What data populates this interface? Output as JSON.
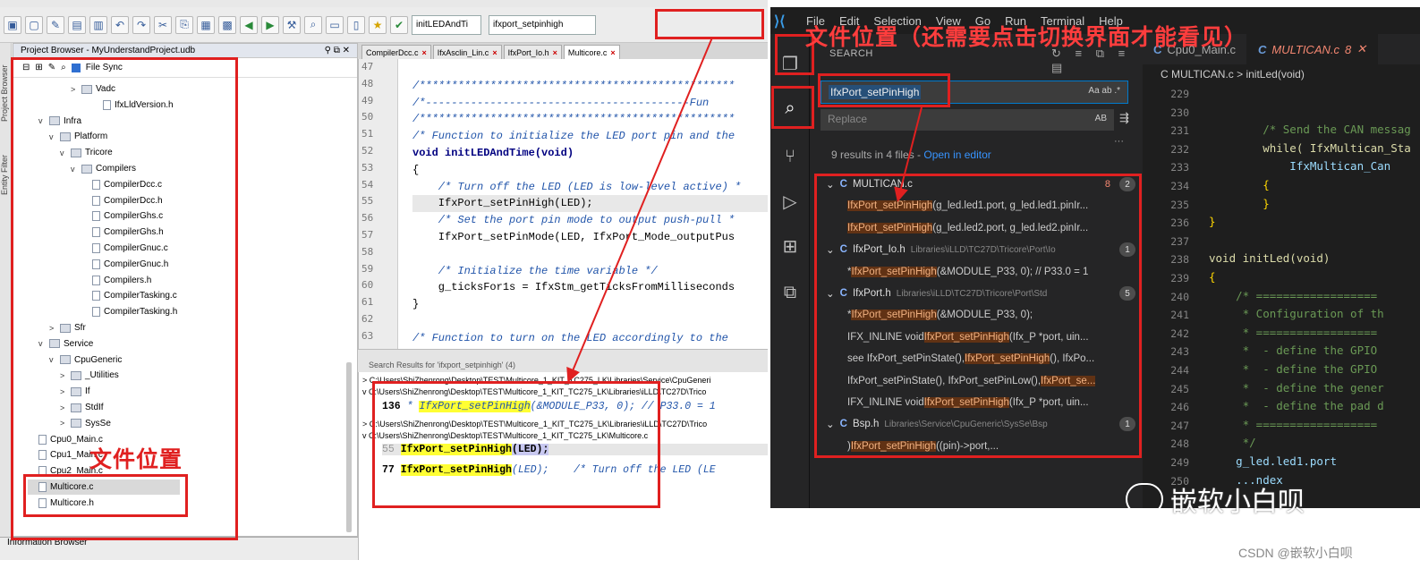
{
  "understand": {
    "search_combo_1": "initLEDAndTi",
    "search_combo_2": "ifxport_setpinhigh",
    "project_browser_title": "Project Browser - MyUnderstandProject.udb",
    "vtab_1": "Project Browser",
    "vtab_2": "Entity Filter",
    "file_sync": "File Sync",
    "tree": [
      {
        "label": "Vadc",
        "kind": "folder",
        "twisty": ">"
      },
      {
        "label": "IfxLldVersion.h",
        "kind": "file",
        "twisty": ""
      },
      {
        "label": "Infra",
        "kind": "folder",
        "twisty": "v"
      },
      {
        "label": "Platform",
        "kind": "folder",
        "twisty": "v"
      },
      {
        "label": "Tricore",
        "kind": "folder",
        "twisty": "v"
      },
      {
        "label": "Compilers",
        "kind": "folder",
        "twisty": "v"
      },
      {
        "label": "CompilerDcc.c",
        "kind": "file",
        "twisty": ""
      },
      {
        "label": "CompilerDcc.h",
        "kind": "file",
        "twisty": ""
      },
      {
        "label": "CompilerGhs.c",
        "kind": "file",
        "twisty": ""
      },
      {
        "label": "CompilerGhs.h",
        "kind": "file",
        "twisty": ""
      },
      {
        "label": "CompilerGnuc.c",
        "kind": "file",
        "twisty": ""
      },
      {
        "label": "CompilerGnuc.h",
        "kind": "file",
        "twisty": ""
      },
      {
        "label": "Compilers.h",
        "kind": "file",
        "twisty": ""
      },
      {
        "label": "CompilerTasking.c",
        "kind": "file",
        "twisty": ""
      },
      {
        "label": "CompilerTasking.h",
        "kind": "file",
        "twisty": ""
      },
      {
        "label": "Sfr",
        "kind": "folder",
        "twisty": ">"
      },
      {
        "label": "Service",
        "kind": "folder",
        "twisty": "v"
      },
      {
        "label": "CpuGeneric",
        "kind": "folder",
        "twisty": "v"
      },
      {
        "label": "_Utilities",
        "kind": "folder",
        "twisty": ">"
      },
      {
        "label": "If",
        "kind": "folder",
        "twisty": ">"
      },
      {
        "label": "StdIf",
        "kind": "folder",
        "twisty": ">"
      },
      {
        "label": "SysSe",
        "kind": "folder",
        "twisty": ">"
      },
      {
        "label": "Cpu0_Main.c",
        "kind": "file",
        "twisty": ""
      },
      {
        "label": "Cpu1_Main.c",
        "kind": "file",
        "twisty": ""
      },
      {
        "label": "Cpu2_Main.c",
        "kind": "file",
        "twisty": ""
      },
      {
        "label": "Multicore.c",
        "kind": "file",
        "twisty": ""
      },
      {
        "label": "Multicore.h",
        "kind": "file",
        "twisty": ""
      }
    ],
    "info_browser": "Information Browser",
    "tabs": [
      "CompilerDcc.c",
      "IfxAsclin_Lin.c",
      "IfxPort_Io.h",
      "Multicore.c"
    ],
    "code_lines": [
      {
        "n": "47",
        "t": ""
      },
      {
        "n": "48",
        "t": "/*************************************************"
      },
      {
        "n": "49",
        "t": "/*-----------------------------------------Fun"
      },
      {
        "n": "50",
        "t": "/*************************************************"
      },
      {
        "n": "51",
        "t": "/* Function to initialize the LED port pin and the"
      },
      {
        "n": "52",
        "t": "void initLEDAndTime(void)"
      },
      {
        "n": "53",
        "t": "{"
      },
      {
        "n": "54",
        "t": "    /* Turn off the LED (LED is low-level active) *"
      },
      {
        "n": "55",
        "t": "    IfxPort_setPinHigh(LED);"
      },
      {
        "n": "56",
        "t": "    /* Set the port pin mode to output push-pull *"
      },
      {
        "n": "57",
        "t": "    IfxPort_setPinMode(LED, IfxPort_Mode_outputPus"
      },
      {
        "n": "58",
        "t": ""
      },
      {
        "n": "59",
        "t": "    /* Initialize the time variable */"
      },
      {
        "n": "60",
        "t": "    g_ticksFor1s = IfxStm_getTicksFromMilliseconds"
      },
      {
        "n": "61",
        "t": "}"
      },
      {
        "n": "62",
        "t": ""
      },
      {
        "n": "63",
        "t": "/* Function to turn on the LED accordingly to the"
      }
    ],
    "search_results_title": "Search Results for 'ifxport_setpinhigh' (4)",
    "sr_paths": [
      "C:\\Users\\ShiZhenrong\\Desktop\\TEST\\Multicore_1_KIT_TC275_LK\\Libraries\\Service\\CpuGeneri",
      "C:\\Users\\ShiZhenrong\\Desktop\\TEST\\Multicore_1_KIT_TC275_LK\\Libraries\\iLLD\\TC27D\\Trico",
      "C:\\Users\\ShiZhenrong\\Desktop\\TEST\\Multicore_1_KIT_TC275_LK\\Libraries\\iLLD\\TC27D\\Trico",
      "C:\\Users\\ShiZhenrong\\Desktop\\TEST\\Multicore_1_KIT_TC275_LK\\Multicore.c"
    ],
    "sr_line_136_no": "136",
    "sr_line_136_pre": "* ",
    "sr_line_136_fn": "IfxPort_setPinHigh",
    "sr_line_136_rest": "(&MODULE_P33, 0); // P33.0 = 1",
    "sr_line_55_no": "55",
    "sr_line_55_fn": "IfxPort_setPinHigh",
    "sr_line_55_rest": "(LED);",
    "sr_line_77_no": "77",
    "sr_line_77_fn": "IfxPort_setPinHigh",
    "sr_line_77_rest": "(LED);    /* Turn off the LED (LE"
  },
  "vscode": {
    "menu": [
      "File",
      "Edit",
      "Selection",
      "View",
      "Go",
      "Run",
      "Terminal",
      "Help"
    ],
    "search_label": "SEARCH",
    "search_value": "IfxPort_setPinHigh",
    "search_opts": "Aa  ab  .*",
    "replace_placeholder": "Replace",
    "replace_opt": "AB",
    "results_count": "9 results in 4 files - ",
    "open_in_editor": "Open in editor",
    "results": [
      {
        "type": "file",
        "name": "MULTICAN.c",
        "path": "",
        "count": "2",
        "err": "8"
      },
      {
        "type": "match",
        "pre": "",
        "hit": "IfxPort_setPinHigh",
        "post": "(g_led.led1.port, g_led.led1.pinIr..."
      },
      {
        "type": "match",
        "pre": "",
        "hit": "IfxPort_setPinHigh",
        "post": "(g_led.led2.port, g_led.led2.pinIr..."
      },
      {
        "type": "file",
        "name": "IfxPort_Io.h",
        "path": "Libraries\\iLLD\\TC27D\\Tricore\\Port\\Io",
        "count": "1",
        "err": ""
      },
      {
        "type": "match",
        "pre": "* ",
        "hit": "IfxPort_setPinHigh",
        "post": "(&MODULE_P33, 0); // P33.0 = 1"
      },
      {
        "type": "file",
        "name": "IfxPort.h",
        "path": "Libraries\\iLLD\\TC27D\\Tricore\\Port\\Std",
        "count": "5",
        "err": ""
      },
      {
        "type": "match",
        "pre": "* ",
        "hit": "IfxPort_setPinHigh",
        "post": "(&MODULE_P33, 0);"
      },
      {
        "type": "match",
        "pre": "IFX_INLINE void ",
        "hit": "IfxPort_setPinHigh",
        "post": "(Ifx_P *port, uin..."
      },
      {
        "type": "match",
        "pre": "see IfxPort_setPinState(), ",
        "hit": "IfxPort_setPinHigh",
        "post": "(), IfxPo..."
      },
      {
        "type": "match",
        "pre": "IfxPort_setPinState(), IfxPort_setPinLow(), ",
        "hit": "IfxPort_se...",
        "post": ""
      },
      {
        "type": "match",
        "pre": "IFX_INLINE void ",
        "hit": "IfxPort_setPinHigh",
        "post": "(Ifx_P *port, uin..."
      },
      {
        "type": "file",
        "name": "Bsp.h",
        "path": "Libraries\\Service\\CpuGeneric\\SysSe\\Bsp",
        "count": "1",
        "err": ""
      },
      {
        "type": "match",
        "pre": ")                          ",
        "hit": "IfxPort_setPinHigh",
        "post": "((pin)->port,..."
      }
    ],
    "tabs": [
      {
        "name": "Cpu0_Main.c",
        "active": false
      },
      {
        "name": "MULTICAN.c",
        "active": true,
        "count": "8"
      }
    ],
    "breadcrumb": "C  MULTICAN.c  >  initLed(void)",
    "lines": [
      {
        "n": "229",
        "t": ""
      },
      {
        "n": "230",
        "t": ""
      },
      {
        "n": "231",
        "t": "        /* Send the CAN messag"
      },
      {
        "n": "232",
        "t": "        while( IfxMultican_Sta"
      },
      {
        "n": "233",
        "t": "            IfxMultican_Can"
      },
      {
        "n": "234",
        "t": "        {"
      },
      {
        "n": "235",
        "t": "        }"
      },
      {
        "n": "236",
        "t": "}"
      },
      {
        "n": "237",
        "t": ""
      },
      {
        "n": "238",
        "t": "void initLed(void)"
      },
      {
        "n": "239",
        "t": "{"
      },
      {
        "n": "240",
        "t": "    /* =================="
      },
      {
        "n": "241",
        "t": "     * Configuration of th"
      },
      {
        "n": "242",
        "t": "     * =================="
      },
      {
        "n": "243",
        "t": "     *  - define the GPIO"
      },
      {
        "n": "244",
        "t": "     *  - define the GPIO"
      },
      {
        "n": "245",
        "t": "     *  - define the gener"
      },
      {
        "n": "246",
        "t": "     *  - define the pad d"
      },
      {
        "n": "247",
        "t": "     * =================="
      },
      {
        "n": "248",
        "t": "     */"
      },
      {
        "n": "249",
        "t": "    g_led.led1.port"
      },
      {
        "n": "250",
        "t": "    ...ndex"
      }
    ]
  },
  "annotations": {
    "left_label": "文件位置",
    "right_label": "文件位置（还需要点击切换界面才能看见）",
    "color": "#e02020"
  },
  "watermark": "嵌软小白呗",
  "credit": "CSDN @嵌软小白呗"
}
